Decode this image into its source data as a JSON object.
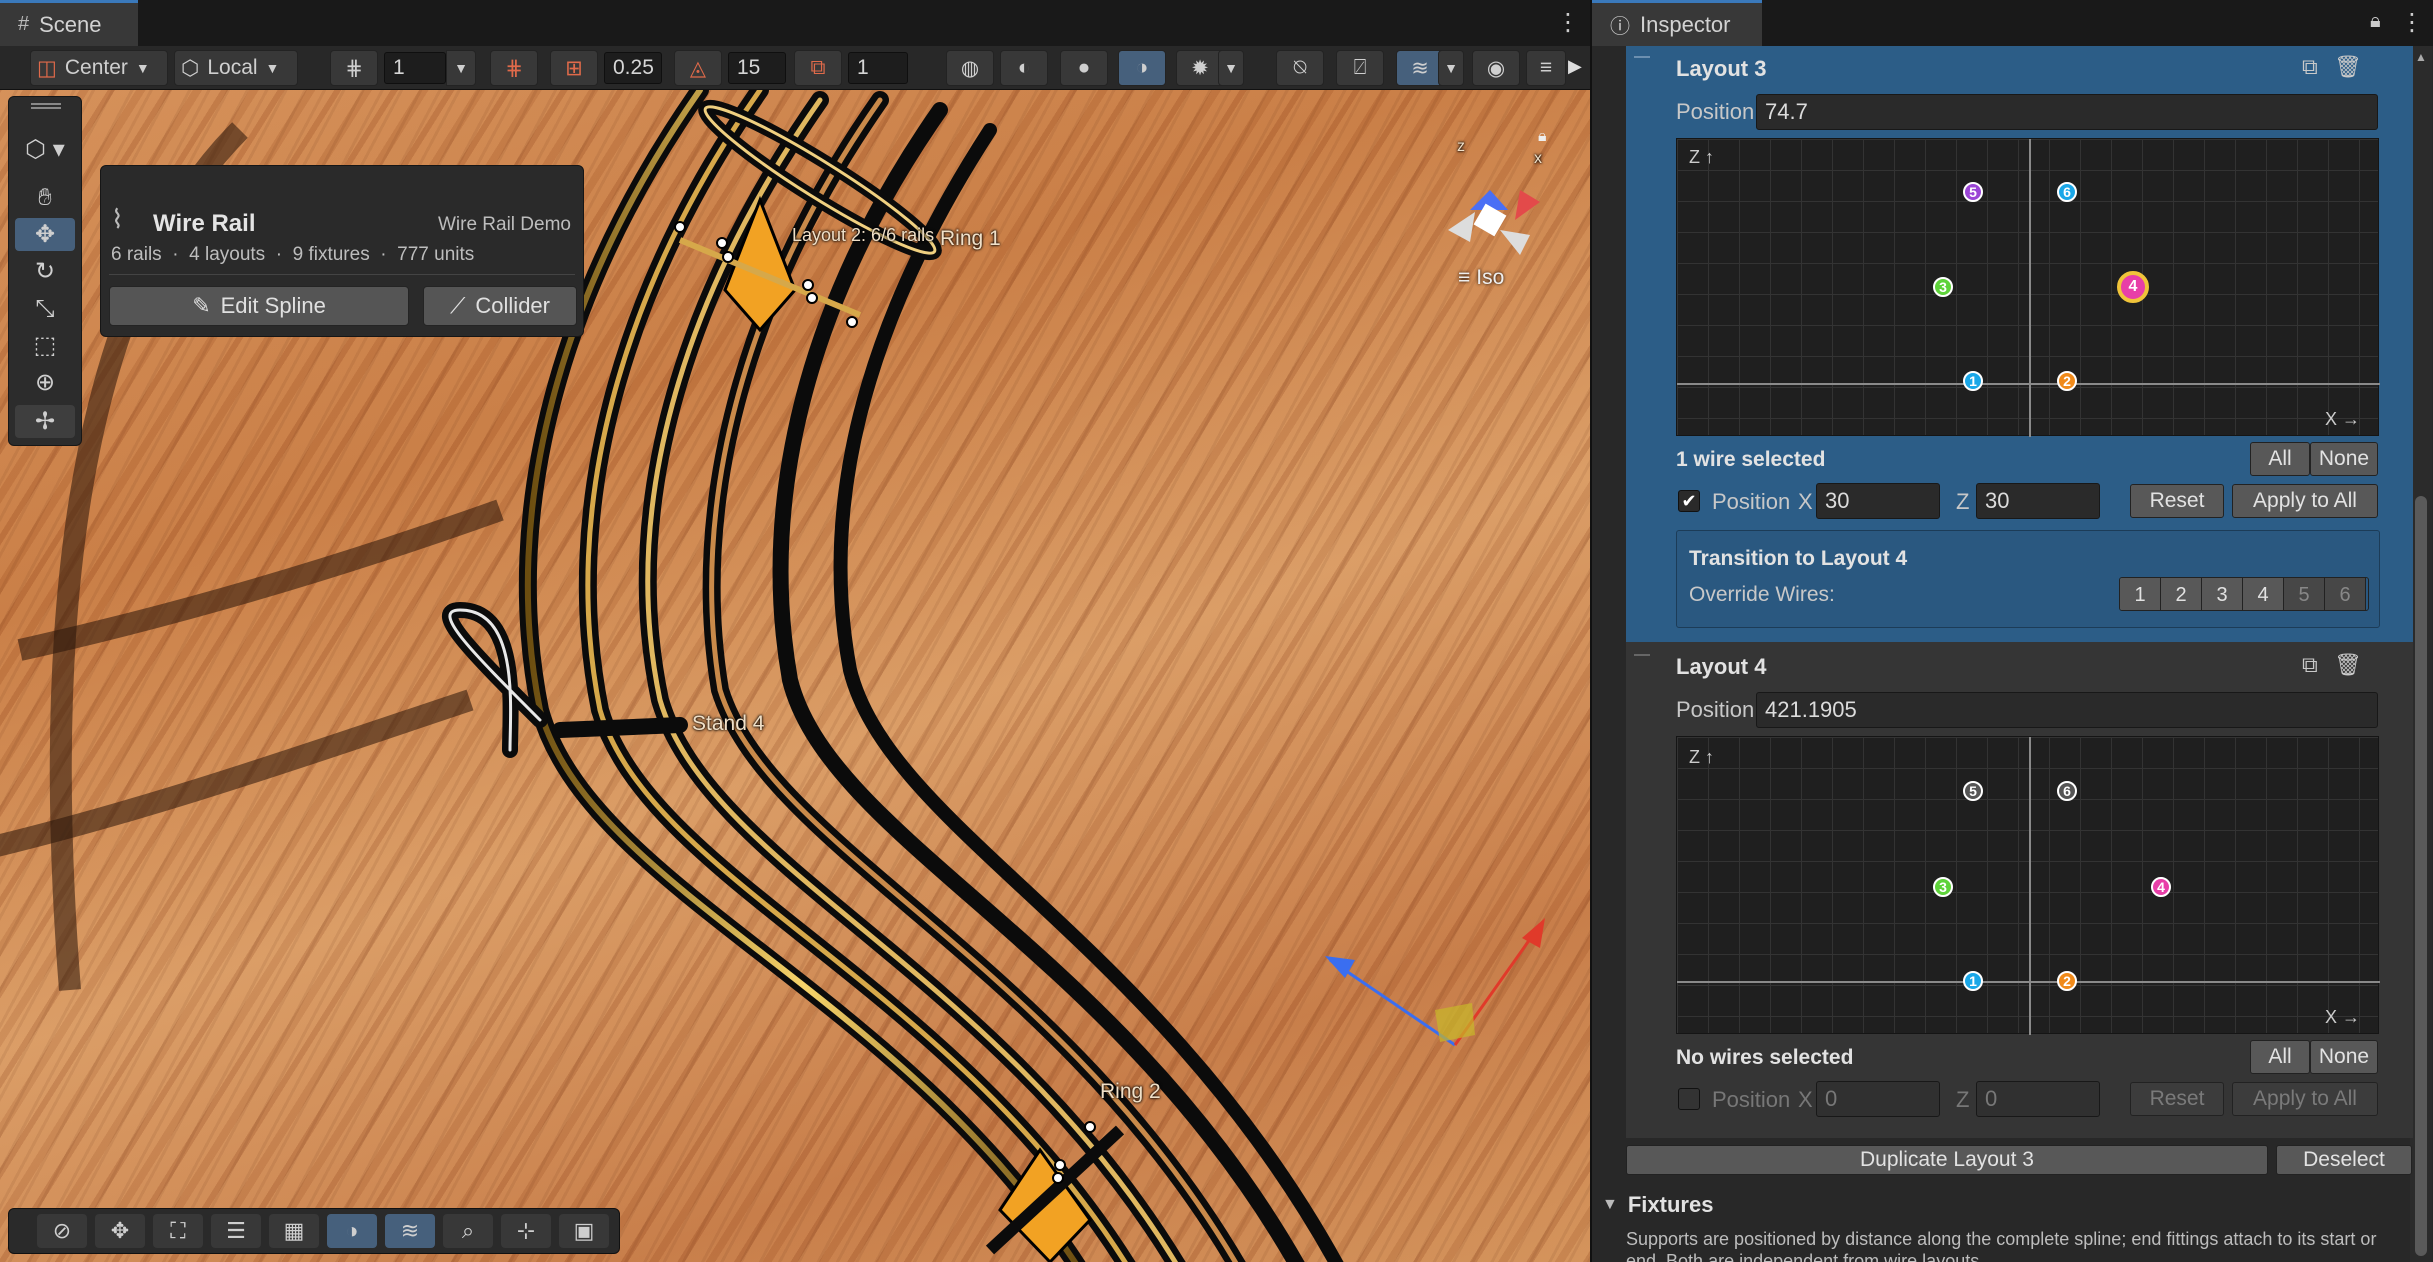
{
  "scene": {
    "tab_label": "Scene",
    "toolbar": {
      "pivot": "Center",
      "space": "Local",
      "grid_value": "1",
      "snap_increment": "0.25",
      "rotate_snap": "15",
      "scale_snap": "1"
    },
    "tools": [
      "hand-tool",
      "move-tool",
      "rotate-tool",
      "scale-tool",
      "rect-tool",
      "transform-tool",
      "custom-tool"
    ],
    "overlay": {
      "title": "Wire Rail",
      "subtitle": "Wire Rail Demo",
      "stats": "6 rails  ·  4 layouts  ·  9 fixtures  ·  777 units",
      "edit_spline": "Edit Spline",
      "collider": "Collider"
    },
    "gizmo_mode": "Iso",
    "gizmo_axes": {
      "z": "z",
      "x": "x"
    },
    "labels": {
      "layout2": "Layout 2: 6/6 rails",
      "ring1": "Ring 1",
      "stand4": "Stand 4",
      "ring2": "Ring 2"
    }
  },
  "inspector": {
    "tab_label": "Inspector",
    "layout3": {
      "title": "Layout 3",
      "position_label": "Position",
      "position_value": "74.7",
      "axis_z": "Z ↑",
      "axis_x": "X →",
      "wires": [
        {
          "n": "1",
          "color": "#1aa7e8"
        },
        {
          "n": "2",
          "color": "#f08a1a"
        },
        {
          "n": "3",
          "color": "#5ed33a"
        },
        {
          "n": "4",
          "color": "#e83ea8"
        },
        {
          "n": "5",
          "color": "#9b45d6"
        },
        {
          "n": "6",
          "color": "#1aa7e8"
        }
      ],
      "selection_text": "1 wire selected",
      "all": "All",
      "none": "None",
      "pos_label": "Position",
      "x_label": "X",
      "x_value": "30",
      "z_label": "Z",
      "z_value": "30",
      "reset": "Reset",
      "apply_all": "Apply to All",
      "transition_title": "Transition to Layout 4",
      "override_label": "Override Wires:",
      "override_buttons": [
        "1",
        "2",
        "3",
        "4",
        "5",
        "6"
      ]
    },
    "layout4": {
      "title": "Layout 4",
      "position_label": "Position",
      "position_value": "421.1905",
      "axis_z": "Z ↑",
      "axis_x": "X →",
      "wires": [
        {
          "n": "1",
          "color": "#1aa7e8"
        },
        {
          "n": "2",
          "color": "#f08a1a"
        },
        {
          "n": "3",
          "color": "#5ed33a"
        },
        {
          "n": "4",
          "color": "#e83ea8"
        },
        {
          "n": "5",
          "color": "#555555"
        },
        {
          "n": "6",
          "color": "#555555"
        }
      ],
      "selection_text": "No wires selected",
      "all": "All",
      "none": "None",
      "pos_label": "Position",
      "x_label": "X",
      "x_value": "0",
      "z_label": "Z",
      "z_value": "0",
      "reset": "Reset",
      "apply_all": "Apply to All"
    },
    "duplicate": "Duplicate Layout 3",
    "deselect": "Deselect",
    "fixtures_title": "Fixtures",
    "fixtures_help": "Supports are positioned by distance along the complete spline; end fittings attach to its start or end. Both are independent from wire layouts."
  }
}
